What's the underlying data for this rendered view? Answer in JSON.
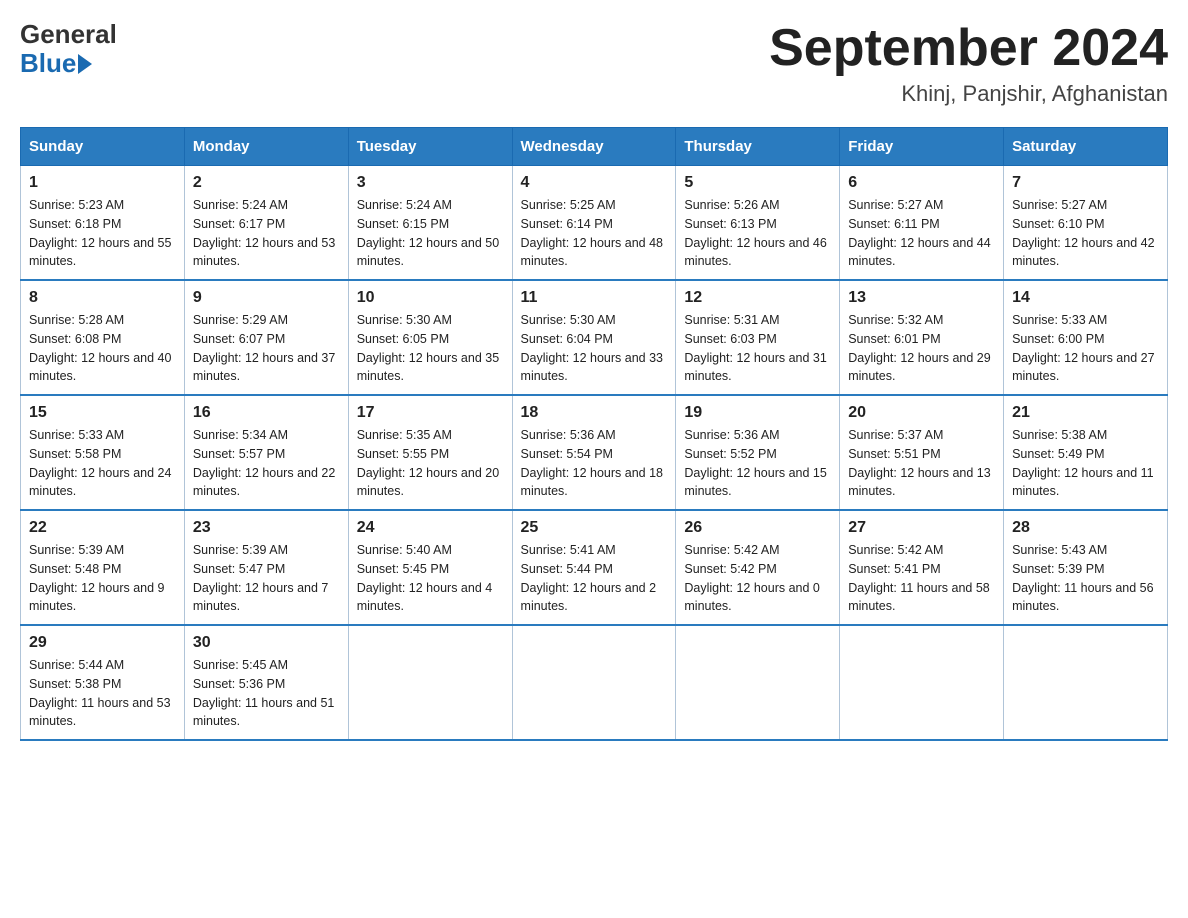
{
  "header": {
    "logo_general": "General",
    "logo_blue": "Blue",
    "title": "September 2024",
    "subtitle": "Khinj, Panjshir, Afghanistan"
  },
  "weekdays": [
    "Sunday",
    "Monday",
    "Tuesday",
    "Wednesday",
    "Thursday",
    "Friday",
    "Saturday"
  ],
  "weeks": [
    [
      {
        "day": "1",
        "sunrise": "5:23 AM",
        "sunset": "6:18 PM",
        "daylight": "12 hours and 55 minutes."
      },
      {
        "day": "2",
        "sunrise": "5:24 AM",
        "sunset": "6:17 PM",
        "daylight": "12 hours and 53 minutes."
      },
      {
        "day": "3",
        "sunrise": "5:24 AM",
        "sunset": "6:15 PM",
        "daylight": "12 hours and 50 minutes."
      },
      {
        "day": "4",
        "sunrise": "5:25 AM",
        "sunset": "6:14 PM",
        "daylight": "12 hours and 48 minutes."
      },
      {
        "day": "5",
        "sunrise": "5:26 AM",
        "sunset": "6:13 PM",
        "daylight": "12 hours and 46 minutes."
      },
      {
        "day": "6",
        "sunrise": "5:27 AM",
        "sunset": "6:11 PM",
        "daylight": "12 hours and 44 minutes."
      },
      {
        "day": "7",
        "sunrise": "5:27 AM",
        "sunset": "6:10 PM",
        "daylight": "12 hours and 42 minutes."
      }
    ],
    [
      {
        "day": "8",
        "sunrise": "5:28 AM",
        "sunset": "6:08 PM",
        "daylight": "12 hours and 40 minutes."
      },
      {
        "day": "9",
        "sunrise": "5:29 AM",
        "sunset": "6:07 PM",
        "daylight": "12 hours and 37 minutes."
      },
      {
        "day": "10",
        "sunrise": "5:30 AM",
        "sunset": "6:05 PM",
        "daylight": "12 hours and 35 minutes."
      },
      {
        "day": "11",
        "sunrise": "5:30 AM",
        "sunset": "6:04 PM",
        "daylight": "12 hours and 33 minutes."
      },
      {
        "day": "12",
        "sunrise": "5:31 AM",
        "sunset": "6:03 PM",
        "daylight": "12 hours and 31 minutes."
      },
      {
        "day": "13",
        "sunrise": "5:32 AM",
        "sunset": "6:01 PM",
        "daylight": "12 hours and 29 minutes."
      },
      {
        "day": "14",
        "sunrise": "5:33 AM",
        "sunset": "6:00 PM",
        "daylight": "12 hours and 27 minutes."
      }
    ],
    [
      {
        "day": "15",
        "sunrise": "5:33 AM",
        "sunset": "5:58 PM",
        "daylight": "12 hours and 24 minutes."
      },
      {
        "day": "16",
        "sunrise": "5:34 AM",
        "sunset": "5:57 PM",
        "daylight": "12 hours and 22 minutes."
      },
      {
        "day": "17",
        "sunrise": "5:35 AM",
        "sunset": "5:55 PM",
        "daylight": "12 hours and 20 minutes."
      },
      {
        "day": "18",
        "sunrise": "5:36 AM",
        "sunset": "5:54 PM",
        "daylight": "12 hours and 18 minutes."
      },
      {
        "day": "19",
        "sunrise": "5:36 AM",
        "sunset": "5:52 PM",
        "daylight": "12 hours and 15 minutes."
      },
      {
        "day": "20",
        "sunrise": "5:37 AM",
        "sunset": "5:51 PM",
        "daylight": "12 hours and 13 minutes."
      },
      {
        "day": "21",
        "sunrise": "5:38 AM",
        "sunset": "5:49 PM",
        "daylight": "12 hours and 11 minutes."
      }
    ],
    [
      {
        "day": "22",
        "sunrise": "5:39 AM",
        "sunset": "5:48 PM",
        "daylight": "12 hours and 9 minutes."
      },
      {
        "day": "23",
        "sunrise": "5:39 AM",
        "sunset": "5:47 PM",
        "daylight": "12 hours and 7 minutes."
      },
      {
        "day": "24",
        "sunrise": "5:40 AM",
        "sunset": "5:45 PM",
        "daylight": "12 hours and 4 minutes."
      },
      {
        "day": "25",
        "sunrise": "5:41 AM",
        "sunset": "5:44 PM",
        "daylight": "12 hours and 2 minutes."
      },
      {
        "day": "26",
        "sunrise": "5:42 AM",
        "sunset": "5:42 PM",
        "daylight": "12 hours and 0 minutes."
      },
      {
        "day": "27",
        "sunrise": "5:42 AM",
        "sunset": "5:41 PM",
        "daylight": "11 hours and 58 minutes."
      },
      {
        "day": "28",
        "sunrise": "5:43 AM",
        "sunset": "5:39 PM",
        "daylight": "11 hours and 56 minutes."
      }
    ],
    [
      {
        "day": "29",
        "sunrise": "5:44 AM",
        "sunset": "5:38 PM",
        "daylight": "11 hours and 53 minutes."
      },
      {
        "day": "30",
        "sunrise": "5:45 AM",
        "sunset": "5:36 PM",
        "daylight": "11 hours and 51 minutes."
      },
      null,
      null,
      null,
      null,
      null
    ]
  ]
}
